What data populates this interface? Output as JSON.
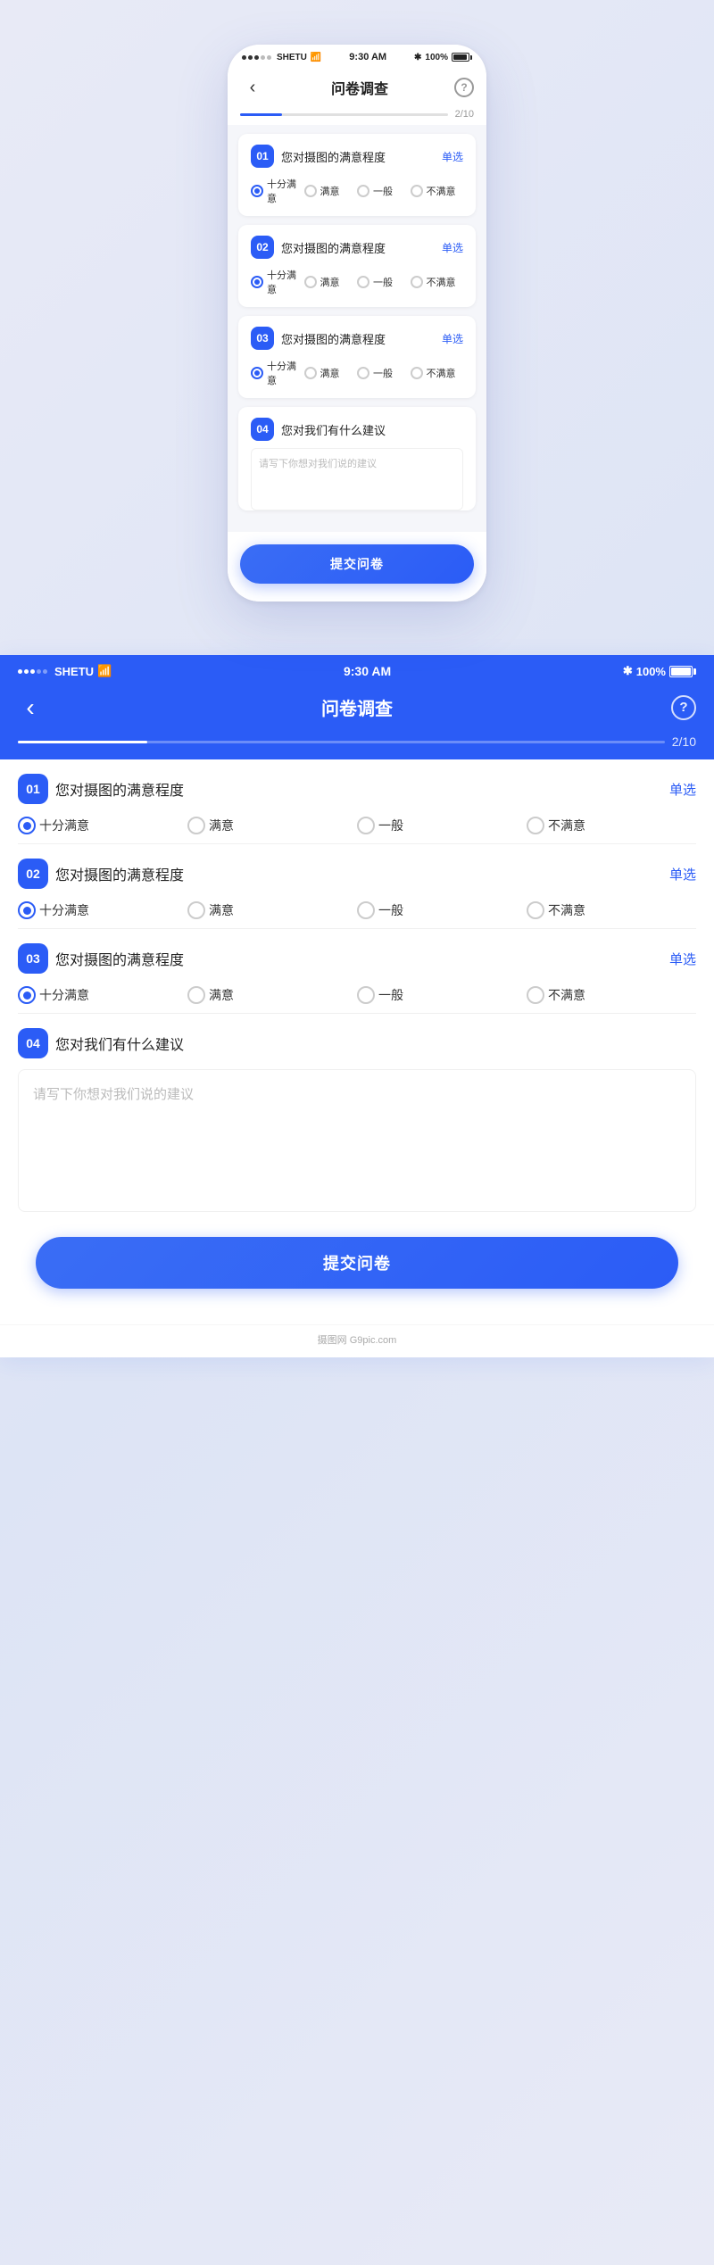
{
  "app": {
    "title": "问卷调查",
    "progress": "2/10",
    "progress_pct": 20,
    "back_label": "‹",
    "help_label": "?",
    "status": {
      "carrier": "SHETU",
      "time": "9:30 AM",
      "battery": "100%",
      "bluetooth": "✱"
    }
  },
  "questions": [
    {
      "id": "01",
      "text": "您对摄图的满意程度",
      "type": "单选",
      "options": [
        "十分满意",
        "满意",
        "一般",
        "不满意"
      ],
      "selected": 0
    },
    {
      "id": "02",
      "text": "您对摄图的满意程度",
      "type": "单选",
      "options": [
        "十分满意",
        "满意",
        "一般",
        "不满意"
      ],
      "selected": 0
    },
    {
      "id": "03",
      "text": "您对摄图的满意程度",
      "type": "单选",
      "options": [
        "十分满意",
        "满意",
        "一般",
        "不满意"
      ],
      "selected": 0
    },
    {
      "id": "04",
      "text": "您对我们有什么建议",
      "type": "",
      "placeholder": "请写下你想对我们说的建议"
    }
  ],
  "submit_label": "提交问卷",
  "watermark": "摄图网 G9pic.com"
}
